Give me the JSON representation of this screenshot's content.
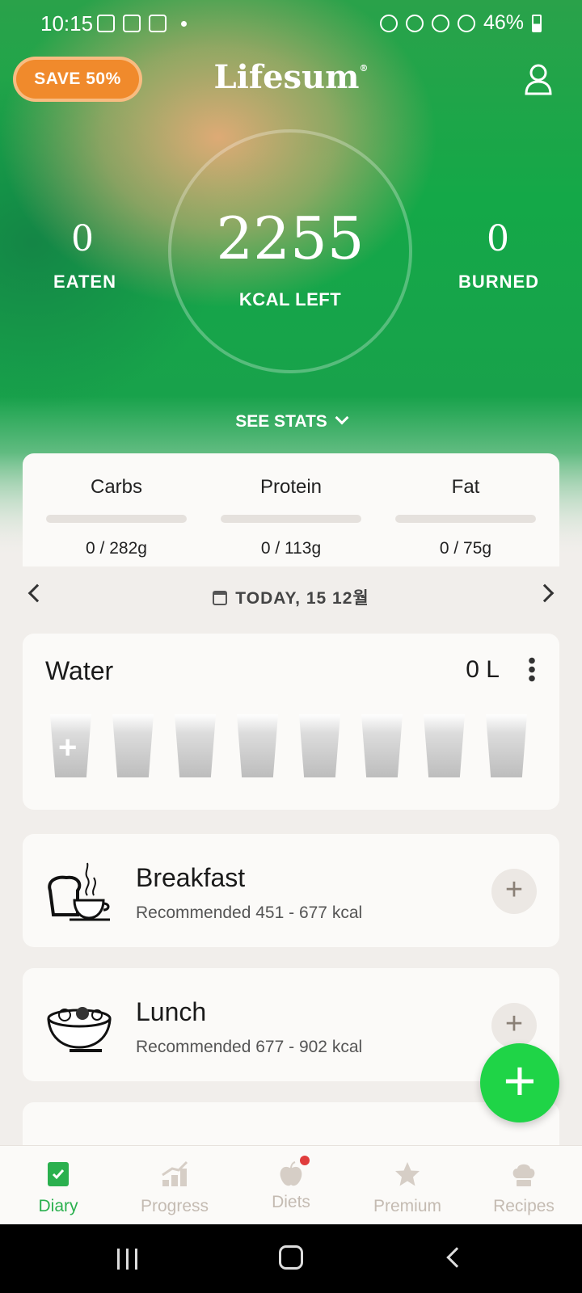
{
  "status_bar": {
    "time": "10:15",
    "battery": "46%"
  },
  "header": {
    "promo_label": "SAVE 50%",
    "logo": "Lifesum",
    "logo_mark": "®"
  },
  "summary": {
    "eaten_value": "0",
    "eaten_label": "EATEN",
    "kcal_left_value": "2255",
    "kcal_left_label": "KCAL LEFT",
    "burned_value": "0",
    "burned_label": "BURNED",
    "see_stats_label": "SEE STATS"
  },
  "macros": [
    {
      "name": "Carbs",
      "value": "0 / 282g",
      "progress": 0
    },
    {
      "name": "Protein",
      "value": "0 / 113g",
      "progress": 0
    },
    {
      "name": "Fat",
      "value": "0 / 75g",
      "progress": 0
    }
  ],
  "date": {
    "label": "TODAY, 15 12월"
  },
  "water": {
    "title": "Water",
    "amount": "0 L",
    "glasses_total": 8,
    "glasses_filled": 0
  },
  "meals": [
    {
      "title": "Breakfast",
      "subtitle": "Recommended 451 - 677 kcal",
      "icon": "breakfast-icon"
    },
    {
      "title": "Lunch",
      "subtitle": "Recommended 677 - 902 kcal",
      "icon": "lunch-icon"
    }
  ],
  "bottom_nav": [
    {
      "label": "Diary",
      "icon": "diary-icon",
      "active": true
    },
    {
      "label": "Progress",
      "icon": "progress-icon"
    },
    {
      "label": "Diets",
      "icon": "diets-icon",
      "badge": true
    },
    {
      "label": "Premium",
      "icon": "star-icon"
    },
    {
      "label": "Recipes",
      "icon": "chef-hat-icon"
    }
  ],
  "colors": {
    "accent_green": "#1fd447",
    "promo_orange": "#f08a2c",
    "active_nav": "#2ab04e"
  }
}
